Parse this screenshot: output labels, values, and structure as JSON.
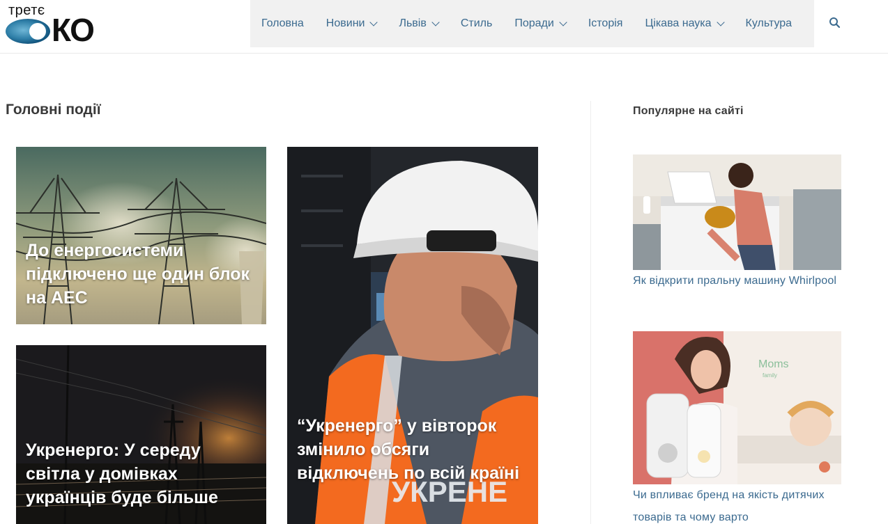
{
  "site": {
    "logo_top": "третє",
    "logo_main": "КО"
  },
  "nav": {
    "items": [
      {
        "label": "Головна",
        "has_dropdown": false
      },
      {
        "label": "Новини",
        "has_dropdown": true
      },
      {
        "label": "Львів",
        "has_dropdown": true
      },
      {
        "label": "Стиль",
        "has_dropdown": false
      },
      {
        "label": "Поради",
        "has_dropdown": true
      },
      {
        "label": "Історія",
        "has_dropdown": false
      },
      {
        "label": "Цікава наука",
        "has_dropdown": true
      },
      {
        "label": "Культура",
        "has_dropdown": false
      }
    ],
    "search_icon": "search-icon"
  },
  "main": {
    "section_title": "Головні події",
    "cards": [
      {
        "title": "До енергосистеми підключено ще один блок на АЕС"
      },
      {
        "title": "Укренерго: У середу світла у домівках українців буде більше"
      },
      {
        "title": "“Укренерго” у вівторок змінило обсяги відключень по всій країні"
      }
    ],
    "card3_vest_text": "УКРЕНЕ"
  },
  "sidebar": {
    "title": "Популярне на сайті",
    "posts": [
      {
        "title": "Як відкрити пральну машину Whirlpool"
      },
      {
        "title": "Чи впливає бренд на якість дитячих товарів та чому варто"
      }
    ],
    "image2_brand": "Moms",
    "image2_brand_sub": "family"
  },
  "colors": {
    "link": "#3b6a8f",
    "nav_bg": "#f1f1f1",
    "text": "#3a3a3a"
  }
}
